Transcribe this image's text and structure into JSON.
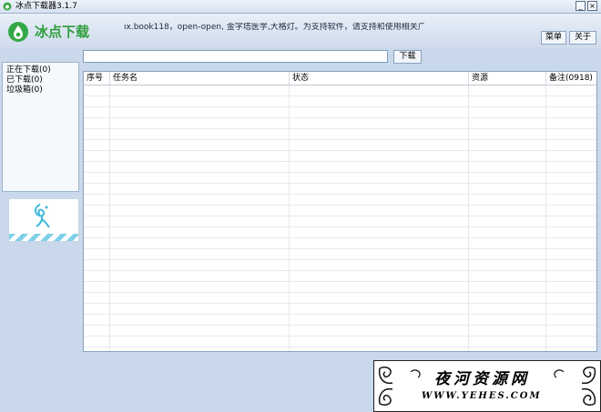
{
  "window": {
    "title": "冰点下载器3.1.7",
    "minimize_label": "_",
    "close_label": "×"
  },
  "header": {
    "logo_text": "冰点下载",
    "ticker": "ıx.book118，open-open, 金字塔医学,大格灯。为支持软件，请支持和使用相关广告。!",
    "menu_label": "菜单",
    "about_label": "关于"
  },
  "sidebar": {
    "items": [
      {
        "label": "正在下载(0)"
      },
      {
        "label": "已下载(0)"
      },
      {
        "label": "垃圾箱(0)"
      }
    ]
  },
  "toolbar": {
    "url_value": "",
    "download_label": "下载"
  },
  "table": {
    "columns": [
      "序号",
      "任务名",
      "状态",
      "资源",
      "备注(0918)"
    ],
    "rows": []
  },
  "watermark": {
    "title": "夜河资源网",
    "url": "WWW.YEHES.COM"
  },
  "colors": {
    "brand_green": "#2e9e3c",
    "background": "#c9d8ea",
    "promo_accent": "#7fd0e8"
  }
}
